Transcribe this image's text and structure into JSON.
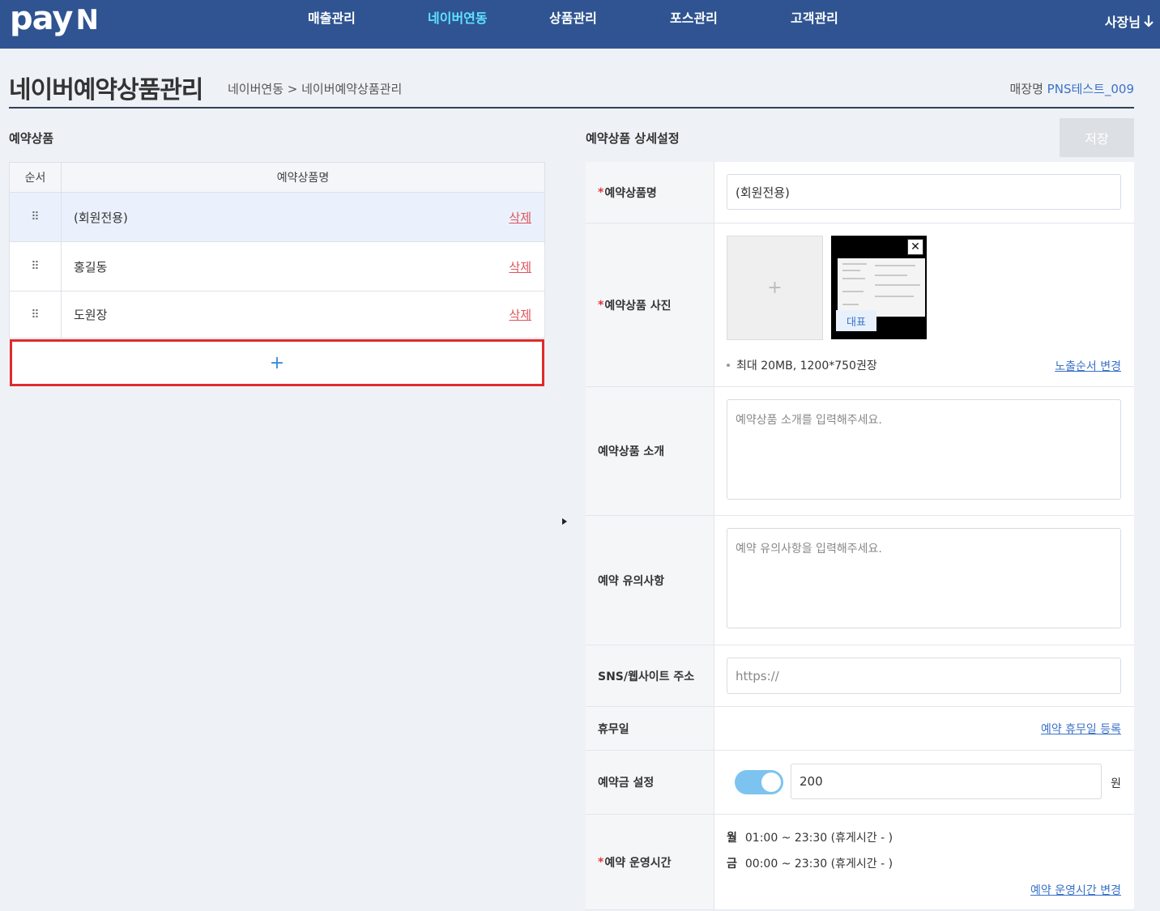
{
  "header": {
    "logo_text": "pay",
    "logo_suffix": "N",
    "nav": [
      "매출관리",
      "네이버연동",
      "상품관리",
      "포스관리",
      "고객관리"
    ],
    "active_nav": "네이버연동",
    "user": "사장님"
  },
  "page": {
    "title": "네이버예약상품관리",
    "breadcrumb": "네이버연동 > 네이버예약상품관리",
    "store_label": "매장명",
    "store_name": "PNS테스트_009"
  },
  "left": {
    "section_title": "예약상품",
    "col_order": "순서",
    "col_name": "예약상품명",
    "rows": [
      {
        "name": "(회원전용)",
        "action": "삭제"
      },
      {
        "name": "홍길동",
        "action": "삭제"
      },
      {
        "name": "도원장",
        "action": "삭제"
      }
    ],
    "drag_icon": "⠿",
    "add_symbol": "+"
  },
  "right": {
    "section_title": "예약상품 상세설정",
    "save_label": "저장",
    "name_label": "예약상품명",
    "name_value": "(회원전용)",
    "photo_label": "예약상품 사진",
    "photo_add": "+",
    "photo_rep": "대표",
    "photo_close": "✕",
    "photo_note": "최대 20MB, 1200*750권장",
    "photo_order_link": "노출순서 변경",
    "intro_label": "예약상품 소개",
    "intro_placeholder": "예약상품 소개를 입력해주세요.",
    "notice_label": "예약 유의사항",
    "notice_placeholder": "예약 유의사항을 입력해주세요.",
    "sns_label": "SNS/웹사이트 주소",
    "sns_value": "https://",
    "holiday_label": "휴무일",
    "holiday_link": "예약 휴무일 등록",
    "deposit_label": "예약금 설정",
    "deposit_enabled": true,
    "deposit_value": "200",
    "deposit_unit": "원",
    "hours_label": "예약 운영시간",
    "hours": [
      {
        "day": "월",
        "time": "01:00 ~ 23:30 (휴게시간 - )"
      },
      {
        "day": "금",
        "time": "00:00 ~ 23:30 (휴게시간 - )"
      }
    ],
    "hours_link": "예약 운영시간 변경"
  },
  "colors": {
    "topbar": "#2f5491",
    "active_nav": "#5fe3ff",
    "link": "#3b72c8",
    "delete": "#e0535a",
    "highlight_border": "#e02b2b"
  }
}
